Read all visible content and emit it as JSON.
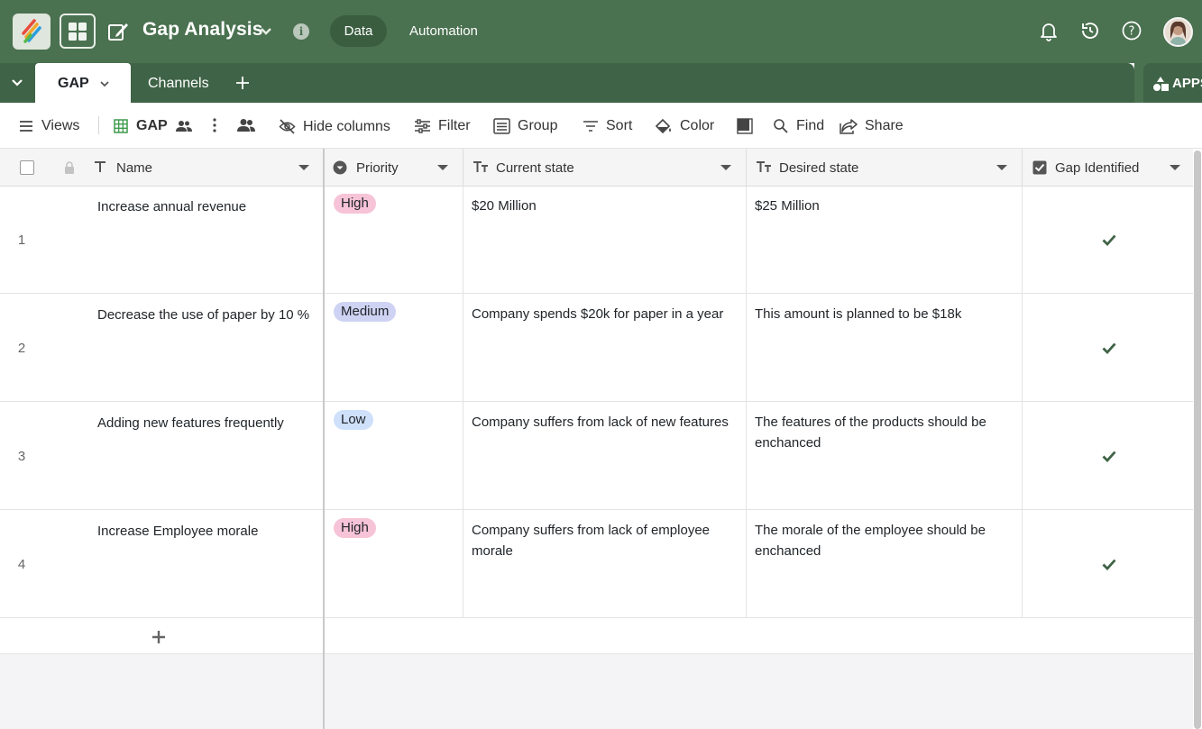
{
  "header": {
    "base_title": "Gap Analysis",
    "nav_data": "Data",
    "nav_automation": "Automation"
  },
  "tabs": {
    "active": "GAP",
    "other": "Channels",
    "apps_label": "APPS"
  },
  "toolbar": {
    "views": "Views",
    "current_view": "GAP",
    "hide_columns": "Hide columns",
    "filter": "Filter",
    "group": "Group",
    "sort": "Sort",
    "color": "Color",
    "find": "Find",
    "share": "Share"
  },
  "columns": {
    "name": "Name",
    "priority": "Priority",
    "current_state": "Current state",
    "desired_state": "Desired state",
    "gap_identified": "Gap Identified"
  },
  "rows": [
    {
      "num": "1",
      "name": "Increase annual revenue",
      "priority": "High",
      "current": "$20 Million",
      "desired": "$25 Million",
      "gap": true
    },
    {
      "num": "2",
      "name": "Decrease the use of paper by 10 %",
      "priority": "Medium",
      "current": "Company spends $20k for paper in a year",
      "desired": "This amount is planned to be $18k",
      "gap": true
    },
    {
      "num": "3",
      "name": "Adding new features frequently",
      "priority": "Low",
      "current": "Company suffers from lack of new features",
      "desired": "The features of the products should be enchanced",
      "gap": true
    },
    {
      "num": "4",
      "name": "Increase Employee morale",
      "priority": "High",
      "current": "Company suffers from lack of employee morale",
      "desired": "The morale of the employee should be enchanced",
      "gap": true
    }
  ],
  "colors": {
    "header_bg": "#4a7150",
    "tabbar_bg": "#3f6346",
    "high": "#f7c3d6",
    "medium": "#cfd3f3",
    "low": "#cfe0fb",
    "check": "#3f6346"
  }
}
